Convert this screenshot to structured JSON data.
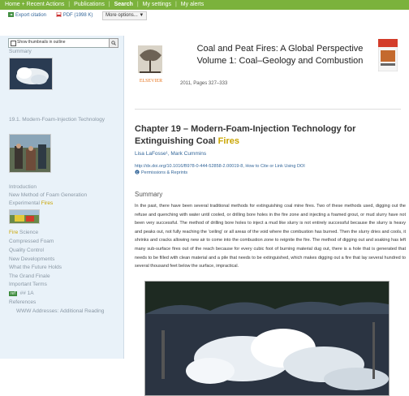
{
  "topnav": {
    "items": [
      "Home + Recent Actions",
      "Publications",
      "Search",
      "My settings",
      "My alerts"
    ],
    "separator": "|"
  },
  "toolbar": {
    "export": "Export citation",
    "pdf": "PDF (1998 K)",
    "more": "More options... ▼"
  },
  "sidebar": {
    "search_label": "Show thumbnails in outline",
    "search_btn_icon": "magnifier-icon",
    "items": {
      "summary": "Summary",
      "section_191": "19.1. Modern-Foam-Injection Technology",
      "introduction": "Introduction",
      "new_method": "New Method of Foam Generation",
      "experimental_a": "Experimental ",
      "experimental_b": "Fires",
      "fire_a": "Fire",
      "fire_b": " Science",
      "compressed": "Compressed Foam",
      "quality": "Quality Control",
      "new_dev": "New Developments",
      "what_future": "What the Future Holds",
      "grand_finale": "The Grand Finale",
      "important": "Important Terms",
      "badge": "ref",
      "badge_suffix": " ## 1A",
      "references": "References",
      "www": "WWW Addresses: Additional Reading"
    }
  },
  "book": {
    "title": "Coal and Peat Fires: A Global Perspective",
    "subtitle": "Volume 1: Coal–Geology and Combustion",
    "publisher": "ELSEVIER",
    "meta": "2011, Pages 327–333"
  },
  "chapter": {
    "title_a": "Chapter 19 – Modern-Foam-Injection Technology for",
    "title_b": "Extinguishing Coal ",
    "title_c": "Fires",
    "authors": "Lisa LaFosse¹, Mark Cummins",
    "doi": "http://dx.doi.org/10.1016/B978-0-444-52858-2.00019-8, How to Cite or Link Using DOI",
    "permissions": "Permissions & Reprints"
  },
  "summary": {
    "heading": "Summary",
    "text": "In the past, there have been several traditional methods for extinguishing coal mine fires. Two of these methods used, digging out the refuse and quenching with water until cooled, or drilling bore holes in the fire zone and injecting a foamed grout, or mud slurry have not been very successful. The method of drilling bore holes to inject a mud like slurry is not entirely successful because the slurry is heavy and peaks out, not fully reaching the 'ceiling' or all areas of the void where the combustion has burned. Then the slurry dries and cools, it shrinks and cracks allowing new air to come into the combustion zone to reignite the fire. The method of digging out and soaking has left many sub-surface fires out of the reach because for every cubic foot of burning material dug out, there is a hole that is generated that needs to be filled with clean material and a pile that needs to be extinguished, which makes digging out a fire that lay several hundred to several thousand feet below the surface, impractical."
  },
  "colors": {
    "nav_green": "#7bb23c",
    "sidebar_bg": "#e9f2f9",
    "link_blue": "#336699",
    "highlight": "#c9a400"
  }
}
